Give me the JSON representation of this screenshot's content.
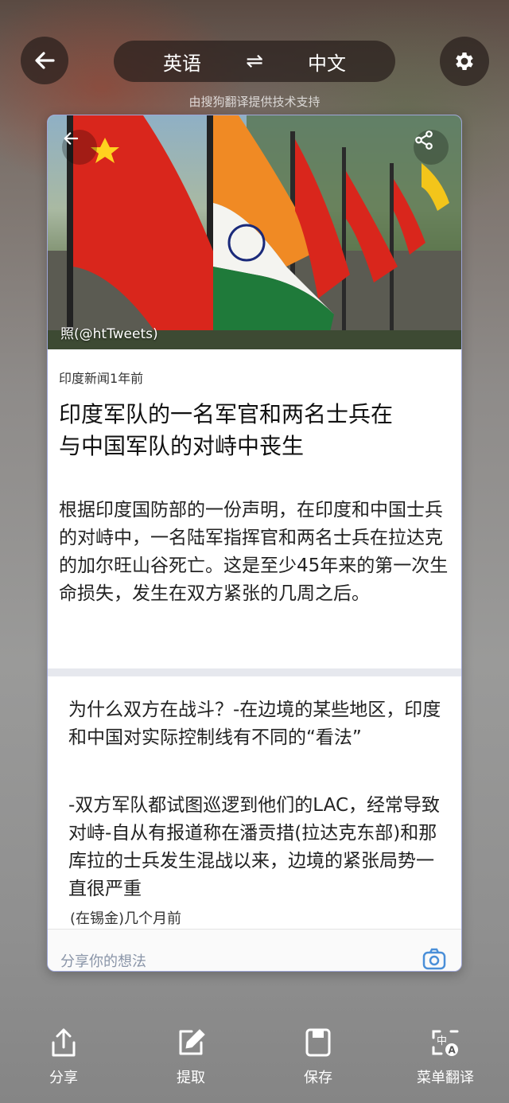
{
  "header": {
    "source_lang": "英语",
    "target_lang": "中文",
    "swap_icon": "⇌",
    "powered_by": "由搜狗翻译提供技术支持"
  },
  "card": {
    "photo_credit": "照(@htTweets)",
    "meta": "印度新闻1年前",
    "headline": "印度军队的一名军官和两名士兵在与中国军队的对峙中丧生",
    "body": "根据印度国防部的一份声明，在印度和中国士兵的对峙中，一名陆军指挥官和两名士兵在拉达克的加尔旺山谷死亡。这是至少45年来的第一次生命损失，发生在双方紧张的几周之后。",
    "sub_title": "为什么双方在战斗？-在边境的某些地区，印度和中国对实际控制线有不同的“看法”",
    "sub_body": "-双方军队都试图巡逻到他们的LAC，经常导致对峙-自从有报道称在潘贡措(拉达克东部)和那库拉的士兵发生混战以来，边境的紧张局势一直很严重",
    "sub_meta": "(在锡金)几个月前",
    "comment_placeholder": "分享你的想法"
  },
  "toolbar": {
    "items": [
      {
        "label": "分享",
        "icon": "share-icon"
      },
      {
        "label": "提取",
        "icon": "edit-icon"
      },
      {
        "label": "保存",
        "icon": "save-icon"
      },
      {
        "label": "菜单翻译",
        "icon": "menu-translate-icon"
      }
    ]
  },
  "colors": {
    "card_border": "#9ea6d8",
    "overlay": "#281e1c",
    "flag_china": "#d9261c",
    "flag_india_saffron": "#f08a24",
    "flag_india_green": "#1f7a3a"
  }
}
